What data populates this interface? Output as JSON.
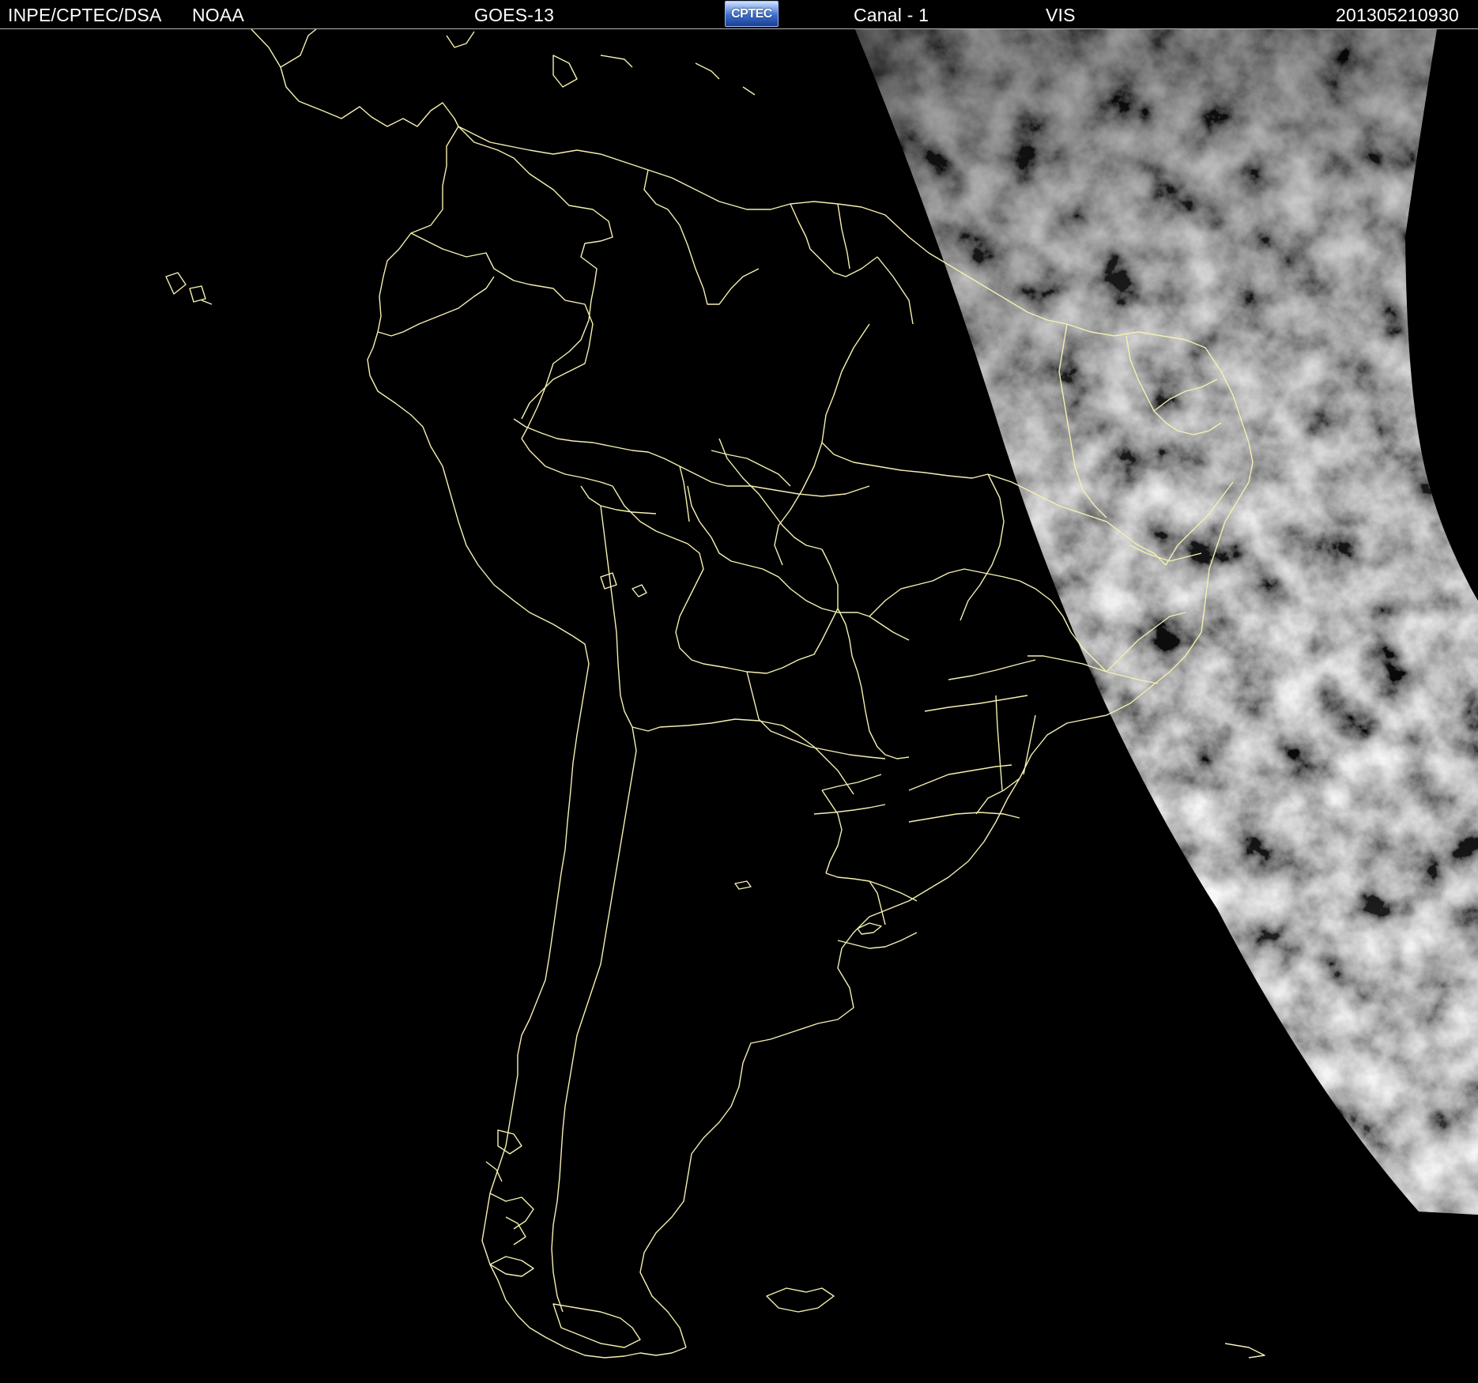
{
  "header": {
    "institution": "INPE/CPTEC/DSA",
    "agency": "NOAA",
    "satellite": "GOES-13",
    "logo_text": "CPTEC",
    "channel": "Canal - 1",
    "band": "VIS",
    "timestamp": "201305210930"
  },
  "map": {
    "region": "South America",
    "image_type": "visible satellite imagery",
    "border_color": "#f5f0b0",
    "background_color": "#000000"
  }
}
